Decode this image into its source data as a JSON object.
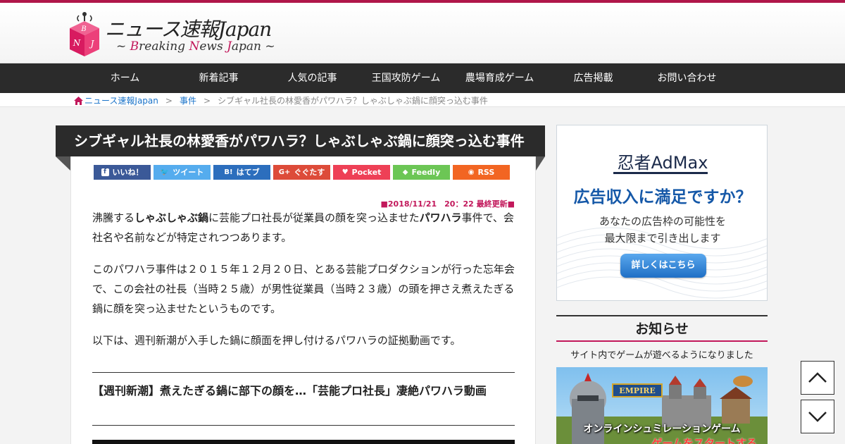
{
  "site": {
    "title": "ニュース速報Japan",
    "subtitle_parts": [
      "~ ",
      "B",
      "reaking ",
      "N",
      "ews ",
      "J",
      "apan ~"
    ],
    "logo_letters": [
      "B",
      "N",
      "J"
    ],
    "accent_color": "#b0174a"
  },
  "nav": {
    "items": [
      {
        "label": "ホーム"
      },
      {
        "label": "新着記事"
      },
      {
        "label": "人気の記事"
      },
      {
        "label": "王国攻防ゲーム"
      },
      {
        "label": "農場育成ゲーム"
      },
      {
        "label": "広告掲載"
      },
      {
        "label": "お問い合わせ"
      }
    ]
  },
  "breadcrumb": {
    "home_icon": "home-icon",
    "home": "ニュース速報Japan",
    "category": "事件",
    "separator": ">",
    "current": "シブギャル社長の林愛香がパワハラ？しゃぶしゃぶ鍋に顔突っ込む事件"
  },
  "article": {
    "title": "シブギャル社長の林愛香がパワハラ？しゃぶしゃぶ鍋に顔突っ込む事件",
    "share": [
      {
        "label": "いいね！",
        "icon": "facebook-icon",
        "color": "#3b5998"
      },
      {
        "label": "ツイート",
        "icon": "twitter-icon",
        "color": "#55acee"
      },
      {
        "label": "はてブ",
        "icon": "hatena-icon",
        "color": "#2c6ebd"
      },
      {
        "label": "ぐぐたす",
        "icon": "googleplus-icon",
        "color": "#dd4b39"
      },
      {
        "label": "Pocket",
        "icon": "pocket-icon",
        "color": "#ee4056"
      },
      {
        "label": "Feedly",
        "icon": "feedly-icon",
        "color": "#6cc655"
      },
      {
        "label": "RSS",
        "icon": "rss-icon",
        "color": "#f26522"
      }
    ],
    "date": "■2018/11/21　20：22 最終更新■",
    "p1": {
      "a": "沸騰する",
      "b": "しゃぶしゃぶ鍋",
      "c": "に芸能プロ社長が従業員の顔を突っ込ませた",
      "d": "パワハラ",
      "e": "事件で、会社名や名前などが特定されつつあります。"
    },
    "p2": "このパワハラ事件は２０１５年１２月２０日、とある芸能プロダクションが行った忘年会で、この会社の社長（当時２５歳）が男性従業員（当時２３歳）の頭を押さえ煮えたぎる鍋に顔を突っ込ませたというものです。",
    "p3": "以下は、週刊新潮が入手した鍋に顔面を押し付けるパワハラの証拠動画です。",
    "video_title": "【週刊新潮】煮えたぎる鍋に部下の顔を…「芸能プロ社長」凄絶パワハラ動画"
  },
  "ad": {
    "logo_a": "忍者",
    "logo_b": "AdMax",
    "headline": "広告収入に満足ですか？",
    "desc1": "あなたの広告枠の可能性を",
    "desc2": "最大限まで引き出します",
    "button": "詳しくはこちら"
  },
  "notice": {
    "heading": "お知らせ",
    "text": "サイト内でゲームが遊べるようになりました",
    "banner_caption": "オンラインシュミレーションゲーム",
    "banner_cta": "ゲームをスタートする",
    "banner_logo": "EMPIRE"
  },
  "scroll": {
    "up_icon": "chevron-up-icon",
    "down_icon": "chevron-down-icon"
  }
}
